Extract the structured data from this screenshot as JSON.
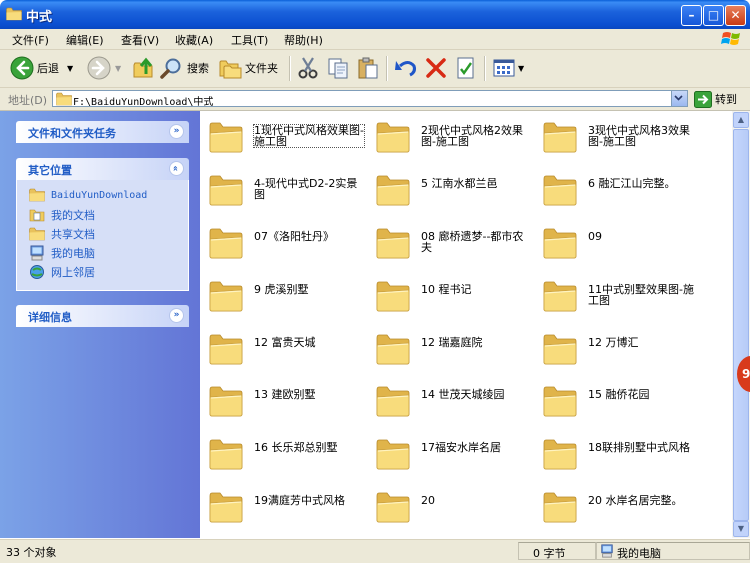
{
  "window": {
    "title": "中式"
  },
  "menu": [
    "文件(F)",
    "编辑(E)",
    "查看(V)",
    "收藏(A)",
    "工具(T)",
    "帮助(H)"
  ],
  "toolbar": {
    "back": "后退",
    "search": "搜索",
    "folders": "文件夹"
  },
  "address": {
    "label": "地址(D)",
    "path": "F:\\BaiduYunDownload\\中式",
    "go": "转到"
  },
  "left_pane": {
    "tasks_title": "文件和文件夹任务",
    "places_title": "其它位置",
    "places": [
      "BaiduYunDownload",
      "我的文档",
      "共享文档",
      "我的电脑",
      "网上邻居"
    ],
    "details_title": "详细信息"
  },
  "folders": [
    "1现代中式风格效果图-施工图",
    "2现代中式风格2效果图-施工图",
    "3现代中式风格3效果图-施工图",
    "4-现代中式D2-2实景图",
    "5 江南水都兰邑",
    "6 融汇江山完整。",
    "07《洛阳牡丹》",
    "08 廊桥遗梦--都市农夫",
    "09",
    "9 虎溪别墅",
    "10 程书记",
    "11中式别墅效果图-施工图",
    "12 富贵天城",
    "12 瑞嘉庭院",
    "12 万博汇",
    "13 建欧别墅",
    "14 世茂天城绫园",
    "15 融侨花园",
    "16 长乐郑总别墅",
    "17福安水岸名居",
    "18联排别墅中式风格",
    "19满庭芳中式风格",
    "20",
    "20 水岸名居完整。"
  ],
  "status": {
    "count": "33 个对象",
    "size": "0 字节",
    "location": "我的电脑"
  },
  "side_badge": "9",
  "icons": {
    "folder": "folder-icon",
    "back": "back-arrow-icon",
    "forward": "forward-arrow-icon",
    "up": "up-folder-icon",
    "search": "search-icon",
    "folders": "folders-icon",
    "cut": "cut-icon",
    "copy": "copy-icon",
    "paste": "paste-icon",
    "undo": "undo-icon",
    "delete": "delete-icon",
    "properties": "properties-icon",
    "views": "views-icon",
    "go": "go-arrow-icon",
    "computer": "computer-icon"
  },
  "colors": {
    "title_blue": "#0b4fd0",
    "link_blue": "#215dc6",
    "folder_yellow": "#f5d56e"
  }
}
